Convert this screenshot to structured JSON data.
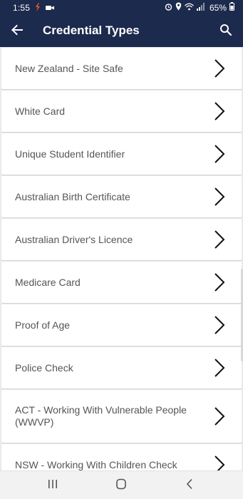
{
  "status_bar": {
    "time": "1:55",
    "battery": "65%",
    "icons_left": [
      "app-notification-icon",
      "video-camera-icon"
    ],
    "icons_right": [
      "alarm-icon",
      "location-icon",
      "wifi-icon",
      "signal-icon",
      "battery-icon"
    ]
  },
  "app_bar": {
    "title": "Credential Types",
    "background": "#1c2a4d",
    "back_icon": "arrow-left-icon",
    "search_icon": "search-icon"
  },
  "credential_types": [
    {
      "label": "New Zealand - Site Safe"
    },
    {
      "label": "White Card"
    },
    {
      "label": "Unique Student Identifier"
    },
    {
      "label": "Australian Birth Certificate"
    },
    {
      "label": "Australian Driver's Licence"
    },
    {
      "label": "Medicare Card"
    },
    {
      "label": "Proof of Age"
    },
    {
      "label": "Police Check"
    },
    {
      "label": "ACT - Working With Vulnerable People (WWVP)"
    },
    {
      "label": "NSW - Working With Children Check"
    }
  ],
  "nav_bar": {
    "recents_icon": "recents-icon",
    "home_icon": "home-icon",
    "back_icon": "nav-back-icon"
  }
}
